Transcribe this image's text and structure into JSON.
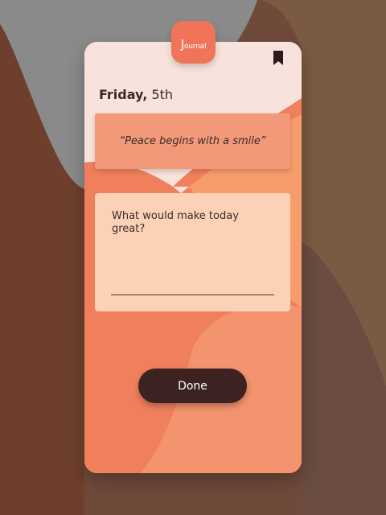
{
  "app": {
    "logo_initial": "J",
    "logo_rest": "ournal",
    "bookmark_icon": "bookmark-icon"
  },
  "header": {
    "day": "Friday,",
    "date": "5th"
  },
  "quote": {
    "text": "“Peace begins with a smile”"
  },
  "prompt": {
    "question": "What would make today great?",
    "answer_value": "",
    "answer_placeholder": ""
  },
  "actions": {
    "done_label": "Done"
  },
  "colors": {
    "accent": "#f07558",
    "button": "#3d2222",
    "card": "#f8e2dc",
    "quote_bg": "#f2997a",
    "prompt_bg": "#fcd2b6"
  }
}
